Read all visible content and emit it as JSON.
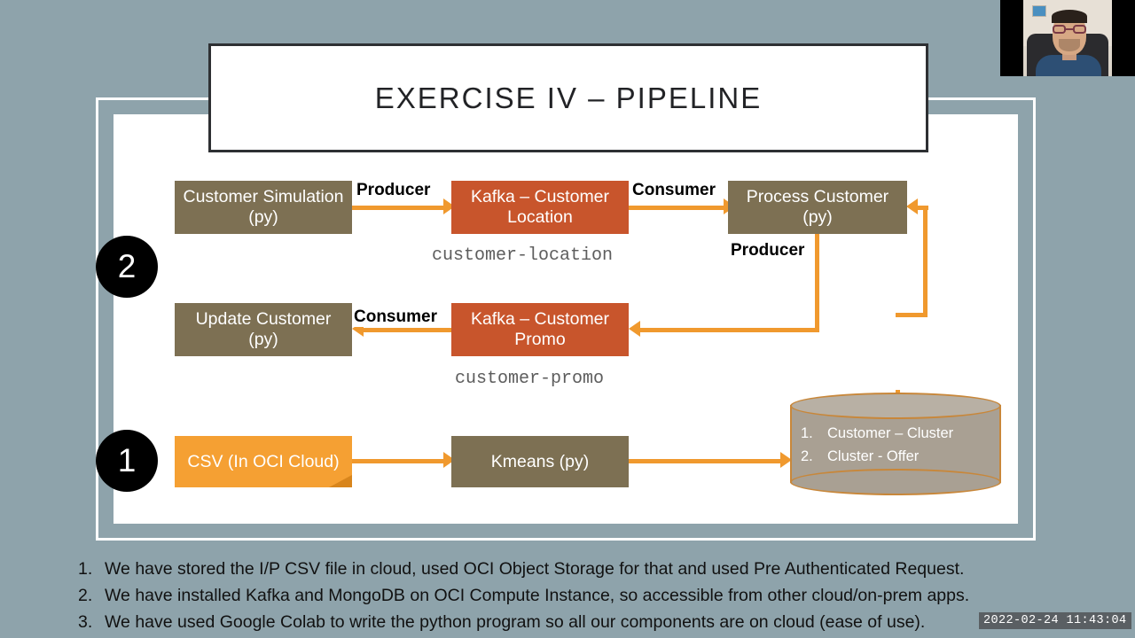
{
  "slide": {
    "title": "EXERCISE IV – PIPELINE",
    "nodes": {
      "customer_simulation": "Customer Simulation (py)",
      "kafka_customer_location": "Kafka – Customer Location",
      "process_customer": "Process Customer (py)",
      "update_customer": "Update Customer (py)",
      "kafka_customer_promo": "Kafka – Customer Promo",
      "csv_in_oci_cloud": "CSV (In OCI Cloud)",
      "kmeans": "Kmeans (py)"
    },
    "topics": {
      "customer_location": "customer-location",
      "customer_promo": "customer-promo"
    },
    "connector_labels": {
      "producer_1": "Producer",
      "consumer_1": "Consumer",
      "producer_2": "Producer",
      "consumer_2": "Consumer"
    },
    "database": {
      "items": [
        {
          "num": "1.",
          "label": "Customer – Cluster"
        },
        {
          "num": "2.",
          "label": "Cluster - Offer"
        }
      ]
    },
    "badges": {
      "badge_two": "2",
      "badge_one": "1"
    },
    "colors": {
      "background": "#8ea3ab",
      "node_brown": "#7d7053",
      "node_kafka_orange": "#c8552c",
      "node_csv_orange": "#f5a033",
      "connector_orange": "#f0992e",
      "database_fill": "#a9a093",
      "database_outline": "#c8873a",
      "title_border": "#2e3033"
    }
  },
  "notes": [
    {
      "num": "1.",
      "text": "We have stored the I/P CSV file in cloud, used OCI Object Storage for that and used Pre Authenticated Request."
    },
    {
      "num": "2.",
      "text": "We have installed Kafka and MongoDB on OCI Compute Instance, so accessible from other cloud/on-prem apps."
    },
    {
      "num": "3.",
      "text": "We have used Google Colab to write the python program so all our components are on cloud (ease of use)."
    }
  ],
  "overlay": {
    "timestamp": "2022-02-24 11:43:04",
    "webcam_label": "webcam-video-feed"
  }
}
